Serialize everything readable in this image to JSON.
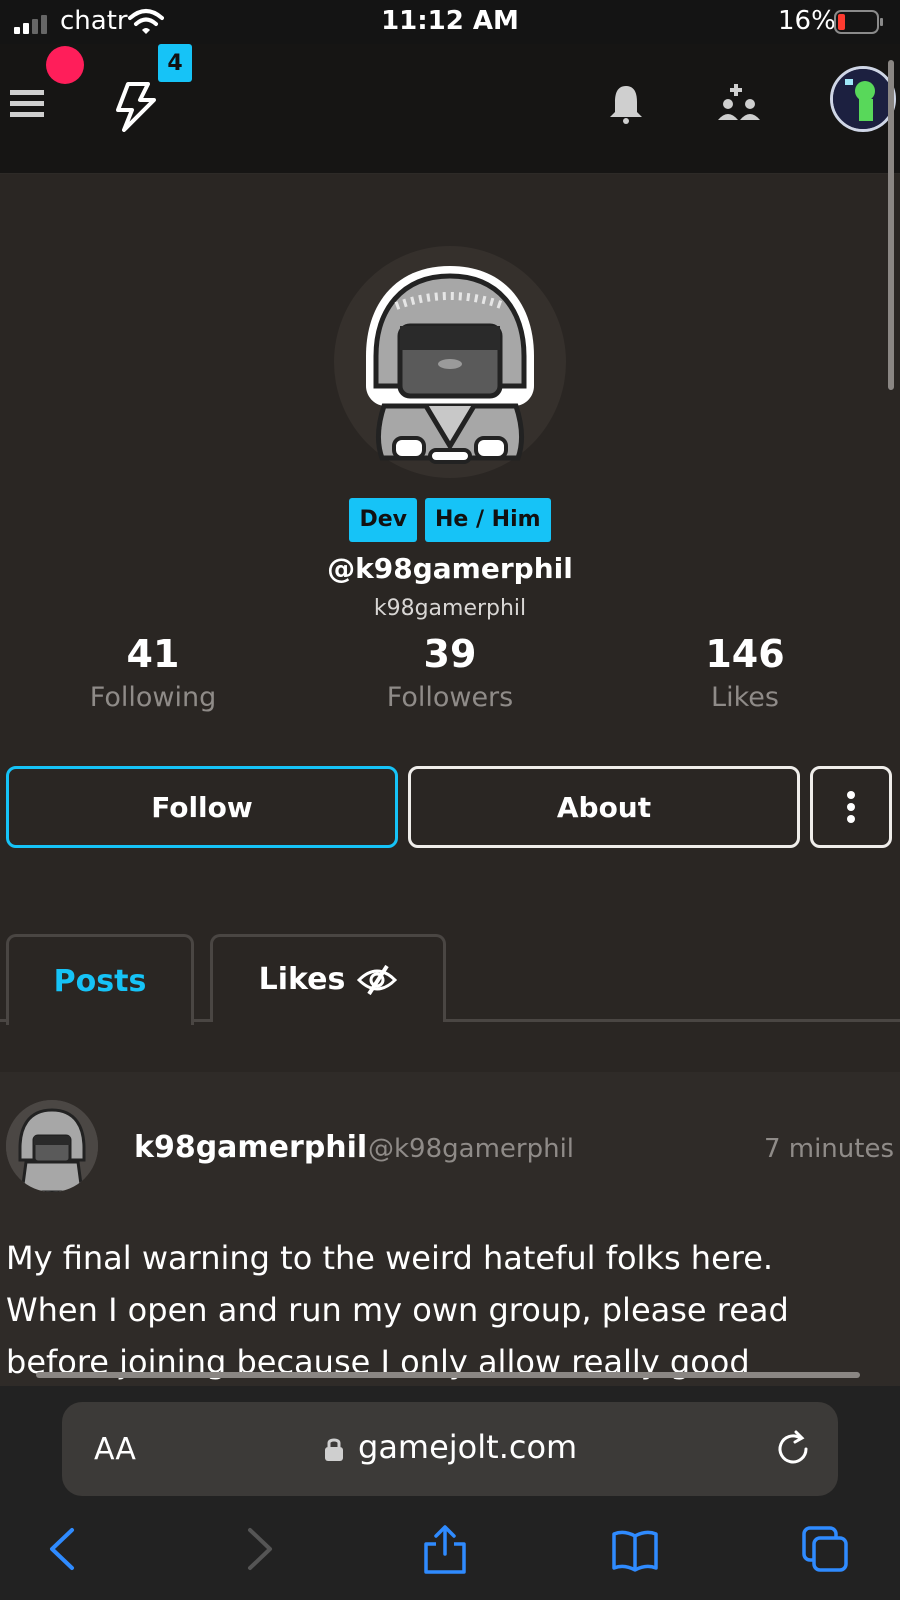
{
  "status_bar": {
    "carrier": "chatr",
    "time": "11:12 AM",
    "battery": "16%"
  },
  "header": {
    "notification_count": "4"
  },
  "profile": {
    "tags": [
      "Dev",
      "He / Him"
    ],
    "display_name": "@k98gamerphil",
    "username": "k98gamerphil",
    "stats": [
      {
        "value": "41",
        "label": "Following"
      },
      {
        "value": "39",
        "label": "Followers"
      },
      {
        "value": "146",
        "label": "Likes"
      }
    ],
    "follow_label": "Follow",
    "about_label": "About"
  },
  "tabs": {
    "posts": "Posts",
    "likes": "Likes"
  },
  "post": {
    "name": "k98gamerphil",
    "handle": "@k98gamerphil",
    "time": "7 minutes",
    "lines": [
      "My final warning to the weird hateful folks here.",
      "When I open and run my own group, please read",
      "before joining because I only allow really good"
    ]
  },
  "browser": {
    "aa": "AA",
    "url": "gamejolt.com"
  },
  "colors": {
    "accent": "#16c3f7",
    "background": "#2a2623",
    "record": "#ff1e5a"
  },
  "icons": [
    "menu-icon",
    "bolt-icon",
    "bell-icon",
    "friends-icon",
    "more-icon",
    "hidden-eye-icon",
    "lock-icon",
    "reload-icon",
    "back-icon",
    "forward-icon",
    "share-icon",
    "bookmarks-icon",
    "tabs-icon"
  ]
}
